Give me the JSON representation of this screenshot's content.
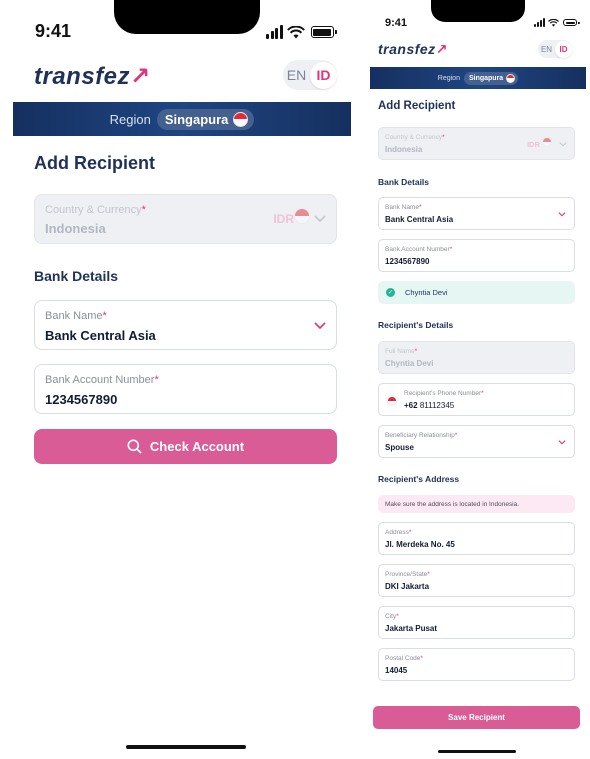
{
  "left": {
    "status": {
      "time": "9:41"
    },
    "logo": "transfez",
    "lang": {
      "en": "EN",
      "id": "ID"
    },
    "region": {
      "label": "Region",
      "value": "Singapura"
    },
    "title": "Add Recipient",
    "country": {
      "label": "Country & Currency",
      "value": "Indonesia",
      "currency": "IDR"
    },
    "bank_details_heading": "Bank Details",
    "bank_name": {
      "label": "Bank Name",
      "value": "Bank Central Asia"
    },
    "account_number": {
      "label": "Bank Account Number",
      "value": "1234567890"
    },
    "check_button": "Check Account"
  },
  "right": {
    "status": {
      "time": "9:41"
    },
    "logo": "transfez",
    "lang": {
      "en": "EN",
      "id": "ID"
    },
    "region": {
      "label": "Region",
      "value": "Singapura"
    },
    "title": "Add Recipient",
    "country": {
      "label": "Country & Currency",
      "value": "Indonesia",
      "currency": "IDR"
    },
    "bank_details_heading": "Bank Details",
    "bank_name": {
      "label": "Bank Name",
      "value": "Bank Central Asia"
    },
    "account_number": {
      "label": "Bank Account Number",
      "value": "1234567890"
    },
    "verified_name": "Chyntia Devi",
    "recipient_details_heading": "Recipient's Details",
    "full_name": {
      "label": "Full Name",
      "value": "Chyntia Devi"
    },
    "phone": {
      "label": "Recipient's Phone Number",
      "code": "+62",
      "value": "81112345"
    },
    "relationship": {
      "label": "Beneficiary Relationship",
      "value": "Spouse"
    },
    "address_heading": "Recipient's Address",
    "address_note": "Make sure the address is located in Indonesia.",
    "address": {
      "label": "Address",
      "value": "Jl. Merdeka No. 45"
    },
    "province": {
      "label": "Province/State",
      "value": "DKI Jakarta"
    },
    "city": {
      "label": "City",
      "value": "Jakarta Pusat"
    },
    "postal": {
      "label": "Postal Code",
      "value": "14045"
    },
    "save_button": "Save Recipient"
  },
  "colors": {
    "accent": "#e0357a",
    "button": "#da5c97",
    "navy": "#1f3158",
    "region_bar": "#1f4582",
    "success": "#26b496"
  }
}
